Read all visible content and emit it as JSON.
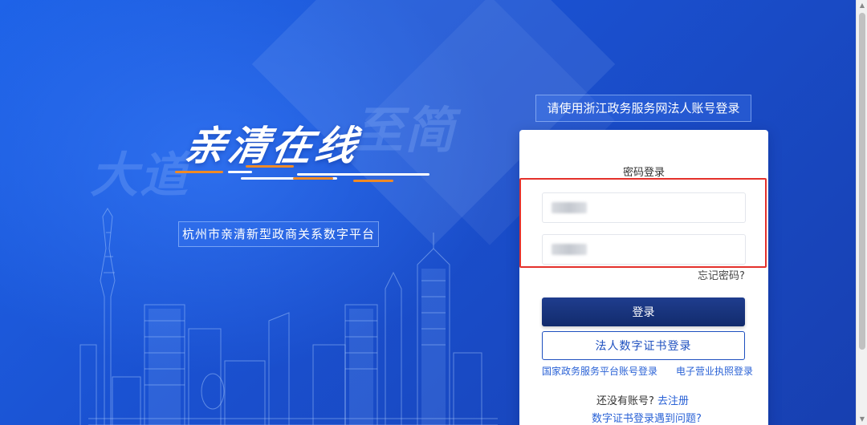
{
  "brand": {
    "logo_text": "亲清在线",
    "ghost_left": "大道",
    "ghost_right": "至简",
    "subtitle": "杭州市亲清新型政商关系数字平台",
    "accent_colors": [
      "#f08a24",
      "#ffffff",
      "#8fb8ff"
    ]
  },
  "login": {
    "hint": "请使用浙江政务服务网法人账号登录",
    "tab_title": "密码登录",
    "username": {
      "value": ""
    },
    "password": {
      "value": ""
    },
    "forgot_label": "忘记密码?",
    "submit_label": "登录",
    "cert_login_label": "法人数字证书登录",
    "national_platform_link": "国家政务服务平台账号登录",
    "business_license_link": "电子营业执照登录",
    "no_account_text": "还没有账号?",
    "register_link": "去注册",
    "cert_problem_link": "数字证书登录遇到问题?",
    "primary_color": "#142f75",
    "link_color": "#2a62d6",
    "highlight_color": "#e4312b"
  },
  "scrollbar": {
    "up_icon": "triangle-up-icon",
    "down_icon": "triangle-down-icon"
  }
}
